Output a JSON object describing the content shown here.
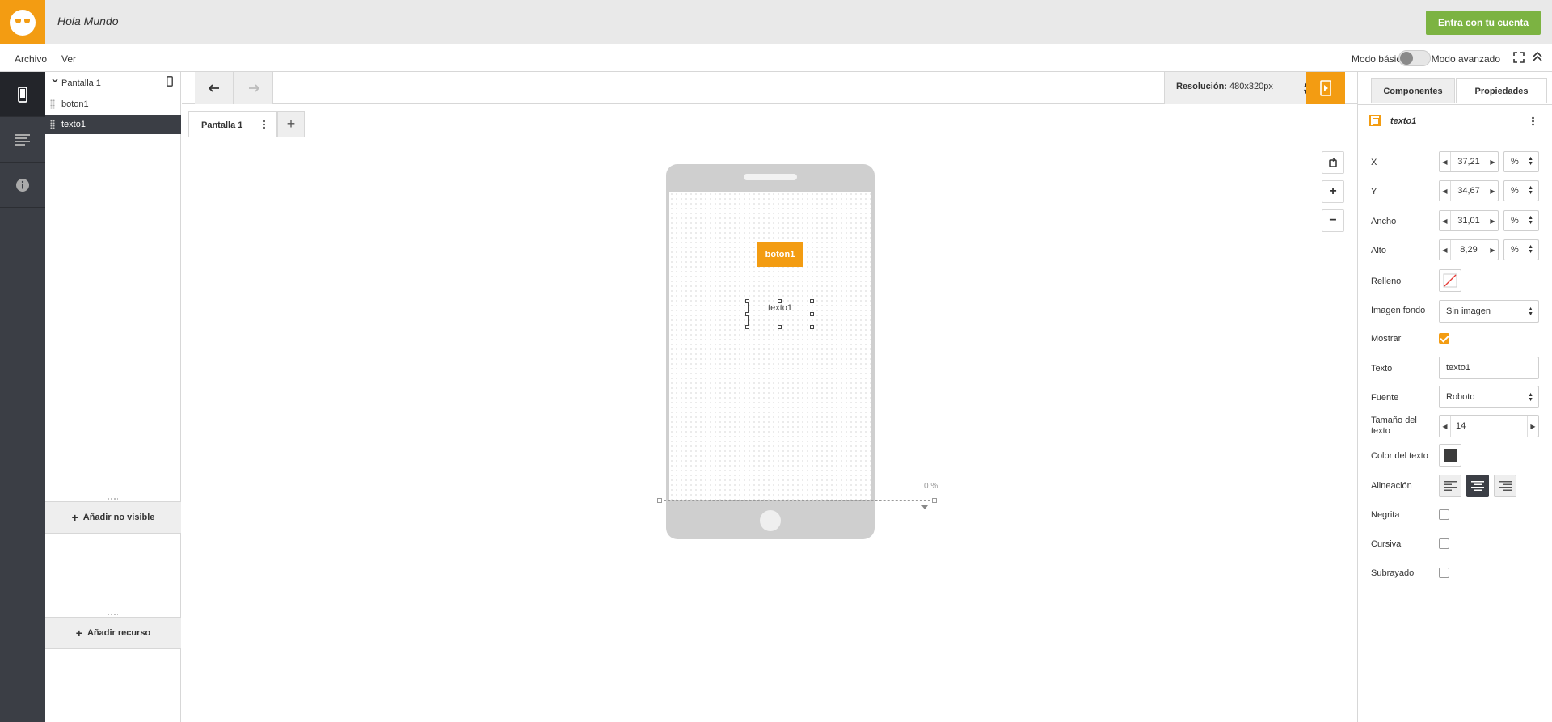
{
  "app": {
    "title": "Hola Mundo",
    "login_label": "Entra con tu cuenta"
  },
  "menu": {
    "items": [
      "Archivo",
      "Ver"
    ],
    "mode_basic": "Modo básico",
    "mode_advanced": "Modo avanzado",
    "advanced_mode_on": false
  },
  "sidebar": {
    "items": [
      "phone-icon",
      "list-icon",
      "info-icon"
    ],
    "active": 0
  },
  "tree": {
    "root_label": "Pantalla 1",
    "items": [
      {
        "label": "boton1",
        "selected": false
      },
      {
        "label": "texto1",
        "selected": true
      }
    ],
    "add_non_visible": "Añadir no visible",
    "add_resource": "Añadir recurso"
  },
  "toolbar": {
    "resolution_label": "Resolución:",
    "resolution_value": "480x320px"
  },
  "tabs": {
    "screen_tab": "Pantalla 1"
  },
  "canvas": {
    "button_label": "boton1",
    "text_label": "texto1",
    "scroll_percent": "0 %"
  },
  "props": {
    "tab_components": "Componentes",
    "tab_properties": "Propiedades",
    "selected_name": "texto1",
    "x": {
      "label": "X",
      "value": "37,21",
      "unit": "%"
    },
    "y": {
      "label": "Y",
      "value": "34,67",
      "unit": "%"
    },
    "width": {
      "label": "Ancho",
      "value": "31,01",
      "unit": "%"
    },
    "height": {
      "label": "Alto",
      "value": "8,29",
      "unit": "%"
    },
    "fill": {
      "label": "Relleno"
    },
    "bg_image": {
      "label": "Imagen fondo",
      "value": "Sin imagen"
    },
    "show": {
      "label": "Mostrar",
      "checked": true
    },
    "text": {
      "label": "Texto",
      "value": "texto1"
    },
    "font": {
      "label": "Fuente",
      "value": "Roboto"
    },
    "text_size": {
      "label": "Tamaño del texto",
      "value": "14"
    },
    "text_color": {
      "label": "Color del texto",
      "color": "#3b3b3b"
    },
    "alignment": {
      "label": "Alineación",
      "active": "center"
    },
    "bold": {
      "label": "Negrita",
      "checked": false
    },
    "italic": {
      "label": "Cursiva",
      "checked": false
    },
    "underline": {
      "label": "Subrayado",
      "checked": false
    }
  },
  "colors": {
    "accent": "#f39c12",
    "login": "#7cb342",
    "dark": "#3b3e45"
  }
}
